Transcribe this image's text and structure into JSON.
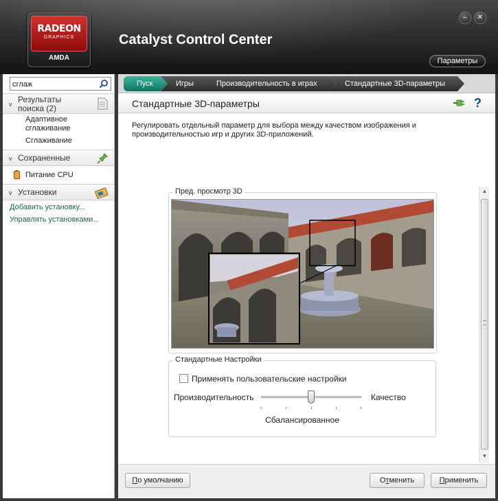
{
  "window": {
    "title": "Catalyst Control Center",
    "logo": {
      "line1": "RADEON",
      "line2": "GRAPHICS",
      "brand": "AMDA"
    },
    "minimize_glyph": "–",
    "close_glyph": "✕",
    "params_label": "Параметры"
  },
  "sidebar": {
    "search": {
      "value": "сглаж",
      "icon": "search-icon"
    },
    "results": {
      "label_line1": "Результаты",
      "label_line2": "поиска (2)",
      "icon": "document-list-icon",
      "items": [
        "Адаптивное сглаживание",
        "Сглаживание"
      ]
    },
    "saved": {
      "label": "Сохраненные",
      "icon": "pin-icon",
      "items": [
        {
          "label": "Питание CPU",
          "icon": "battery-icon"
        }
      ]
    },
    "presets": {
      "label": "Установки",
      "icon": "presets-icon",
      "links": [
        "Добавить установку...",
        "Управлять установками..."
      ]
    }
  },
  "breadcrumbs": [
    "Пуск",
    "Игры",
    "Производительность в играх",
    "Стандартные 3D-параметры"
  ],
  "page": {
    "title": "Стандартные 3D-параметры",
    "pin_icon": "pin-icon",
    "help_icon": "help-icon",
    "help_glyph": "?",
    "description": "Регулировать отдельный параметр для выбора между качеством изображения и производительностью игр и других 3D-приложений.",
    "preview": {
      "title": "Пред. просмотр 3D"
    },
    "settings": {
      "title": "Стандартные Настройки",
      "custom_checkbox": {
        "label": "Применять пользовательские настройки",
        "checked": false
      },
      "slider": {
        "left_label": "Производительность",
        "right_label": "Качество",
        "value_label": "Сбалансированное",
        "position": 0.5
      }
    }
  },
  "footer": {
    "default_btn": {
      "underline": "П",
      "rest": "о умолчанию"
    },
    "cancel_btn": {
      "prefix": "О",
      "underline": "т",
      "rest": "менить"
    },
    "apply_btn": {
      "underline": "П",
      "rest": "рименить"
    }
  },
  "scroll_up_glyph": "▲",
  "scroll_down_glyph": "▼",
  "chevron_glyph": "v",
  "colors": {
    "accent": "#10745d",
    "link": "#1a6b3c",
    "header_bg": "#2a2a2a"
  }
}
